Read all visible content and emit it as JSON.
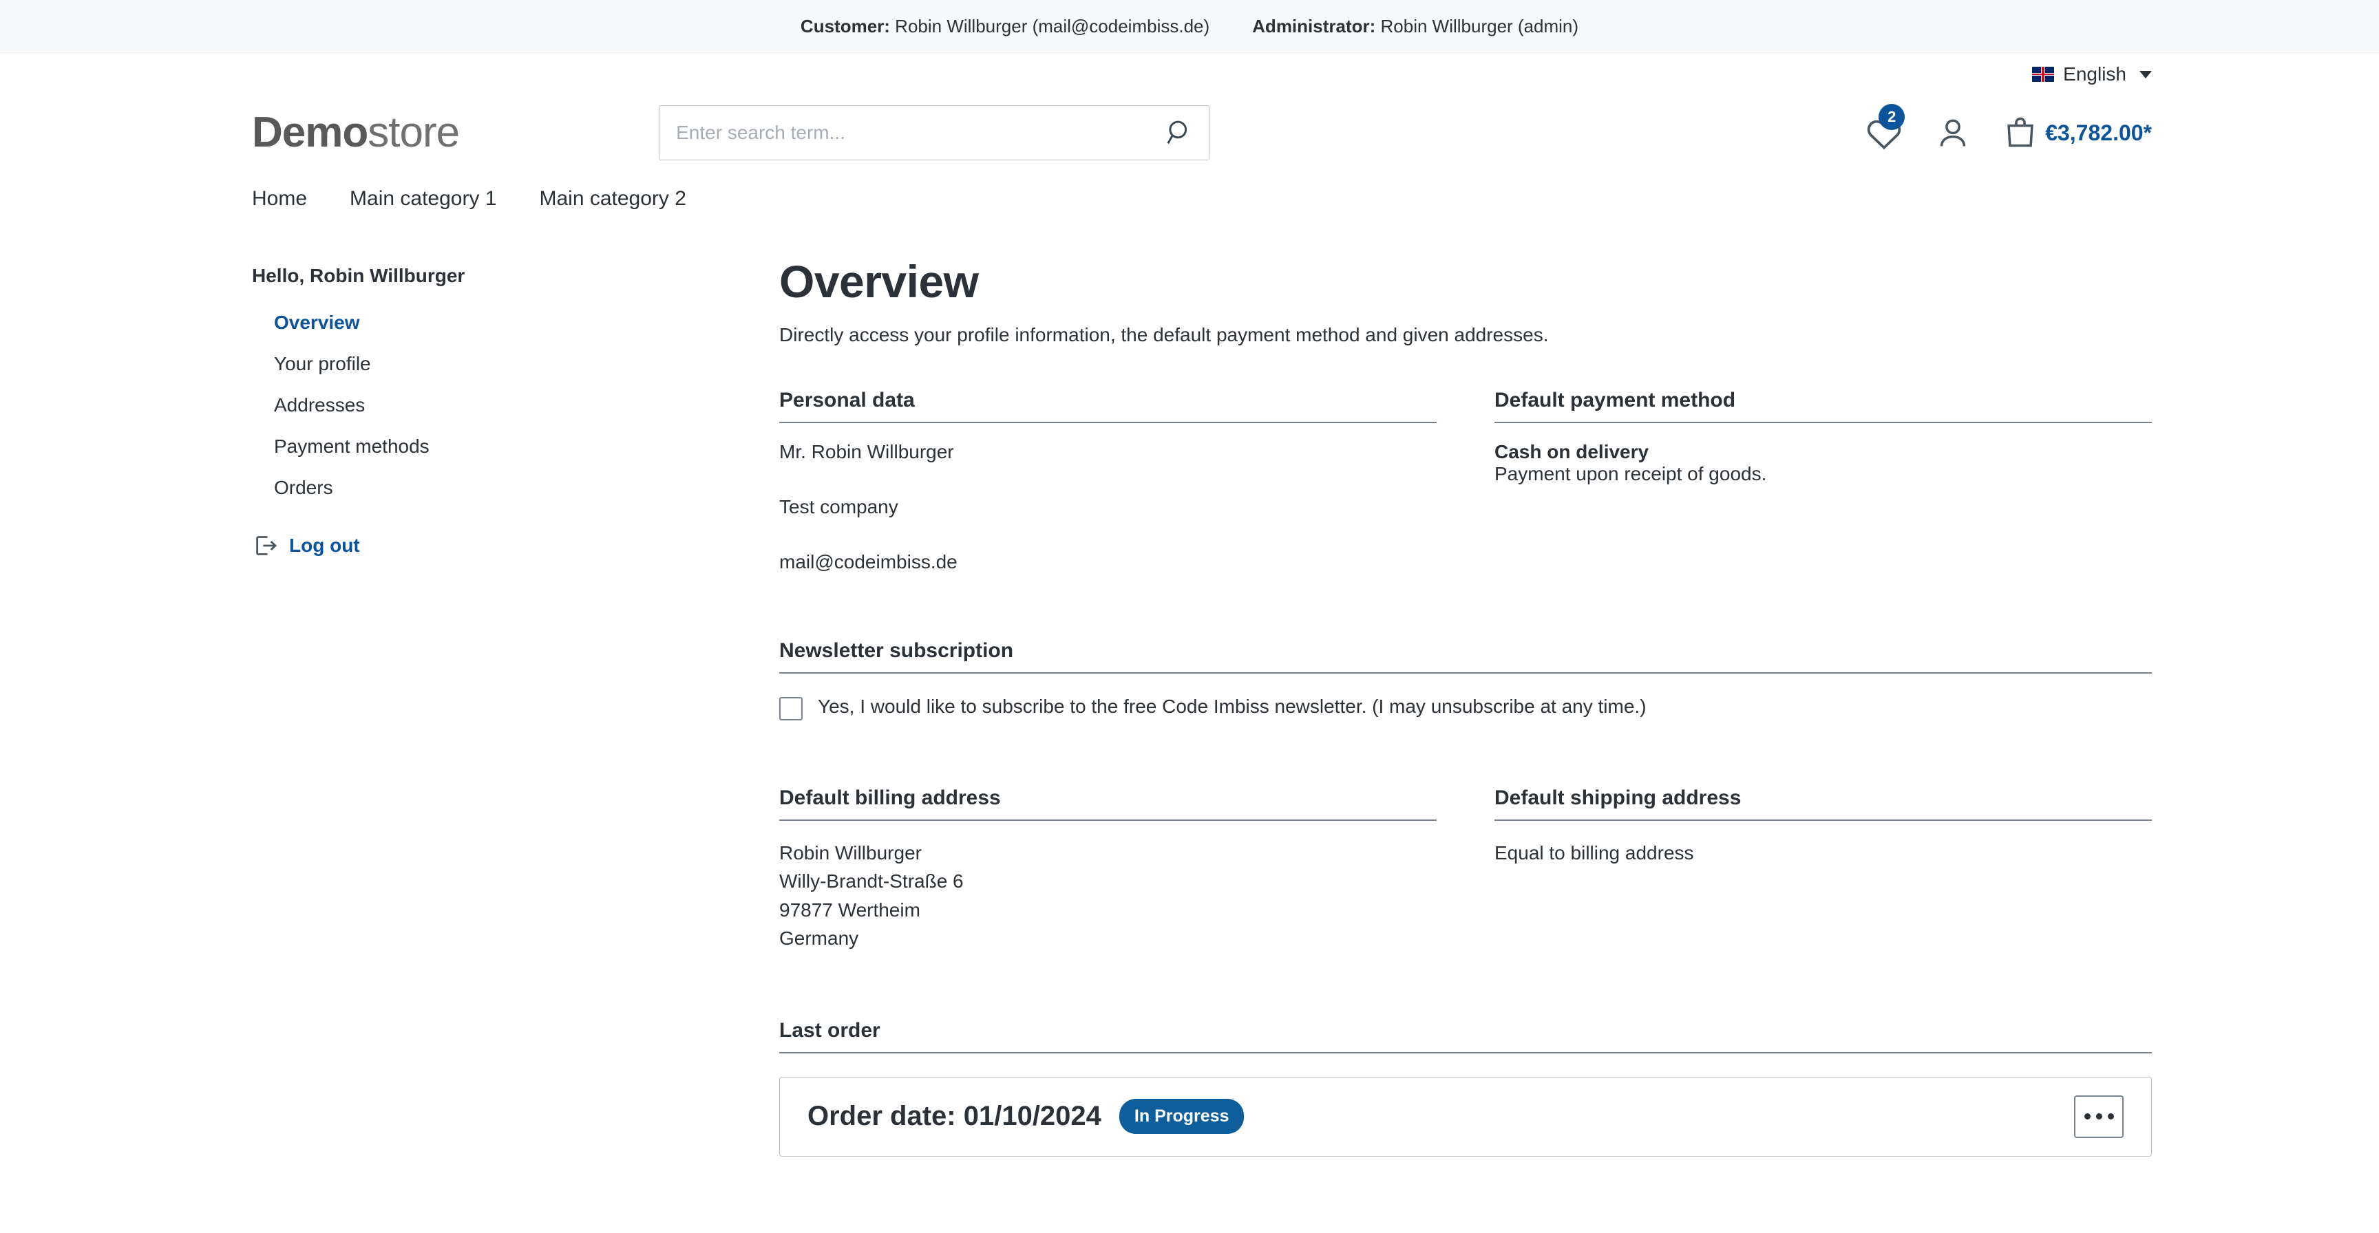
{
  "topbar": {
    "customer_label": "Customer:",
    "customer_value": "Robin Willburger (mail@codeimbiss.de)",
    "admin_label": "Administrator:",
    "admin_value": "Robin Willburger (admin)"
  },
  "language": {
    "name": "English",
    "flag": "uk-flag-icon"
  },
  "logo": {
    "bold": "Demo",
    "light": "store"
  },
  "search": {
    "placeholder": "Enter search term...",
    "value": ""
  },
  "header_actions": {
    "wishlist_count": "2",
    "cart_total": "€3,782.00*"
  },
  "nav": [
    {
      "label": "Home"
    },
    {
      "label": "Main category 1"
    },
    {
      "label": "Main category 2"
    }
  ],
  "sidebar": {
    "greeting": "Hello, Robin Willburger",
    "items": [
      {
        "label": "Overview",
        "active": true
      },
      {
        "label": "Your profile",
        "active": false
      },
      {
        "label": "Addresses",
        "active": false
      },
      {
        "label": "Payment methods",
        "active": false
      },
      {
        "label": "Orders",
        "active": false
      }
    ],
    "logout_label": "Log out"
  },
  "main": {
    "title": "Overview",
    "lead": "Directly access your profile information, the default payment method and given addresses.",
    "personal_data": {
      "heading": "Personal data",
      "name": "Mr. Robin Willburger",
      "company": "Test company",
      "email": "mail@codeimbiss.de"
    },
    "payment_method": {
      "heading": "Default payment method",
      "name": "Cash on delivery",
      "description": "Payment upon receipt of goods."
    },
    "newsletter": {
      "heading": "Newsletter subscription",
      "label": "Yes, I would like to subscribe to the free Code Imbiss newsletter. (I may unsubscribe at any time.)",
      "checked": false
    },
    "billing_address": {
      "heading": "Default billing address",
      "line1": "Robin Willburger",
      "line2": "Willy-Brandt-Straße 6",
      "line3": "97877 Wertheim",
      "line4": "Germany"
    },
    "shipping_address": {
      "heading": "Default shipping address",
      "line1": "Equal to billing address"
    },
    "last_order": {
      "heading": "Last order",
      "order_date": "Order date: 01/10/2024",
      "status": "In Progress"
    }
  },
  "colors": {
    "accent_blue": "#0b539b",
    "status_blue": "#0f5e9c",
    "text": "#2b3136",
    "rule": "#798490"
  }
}
